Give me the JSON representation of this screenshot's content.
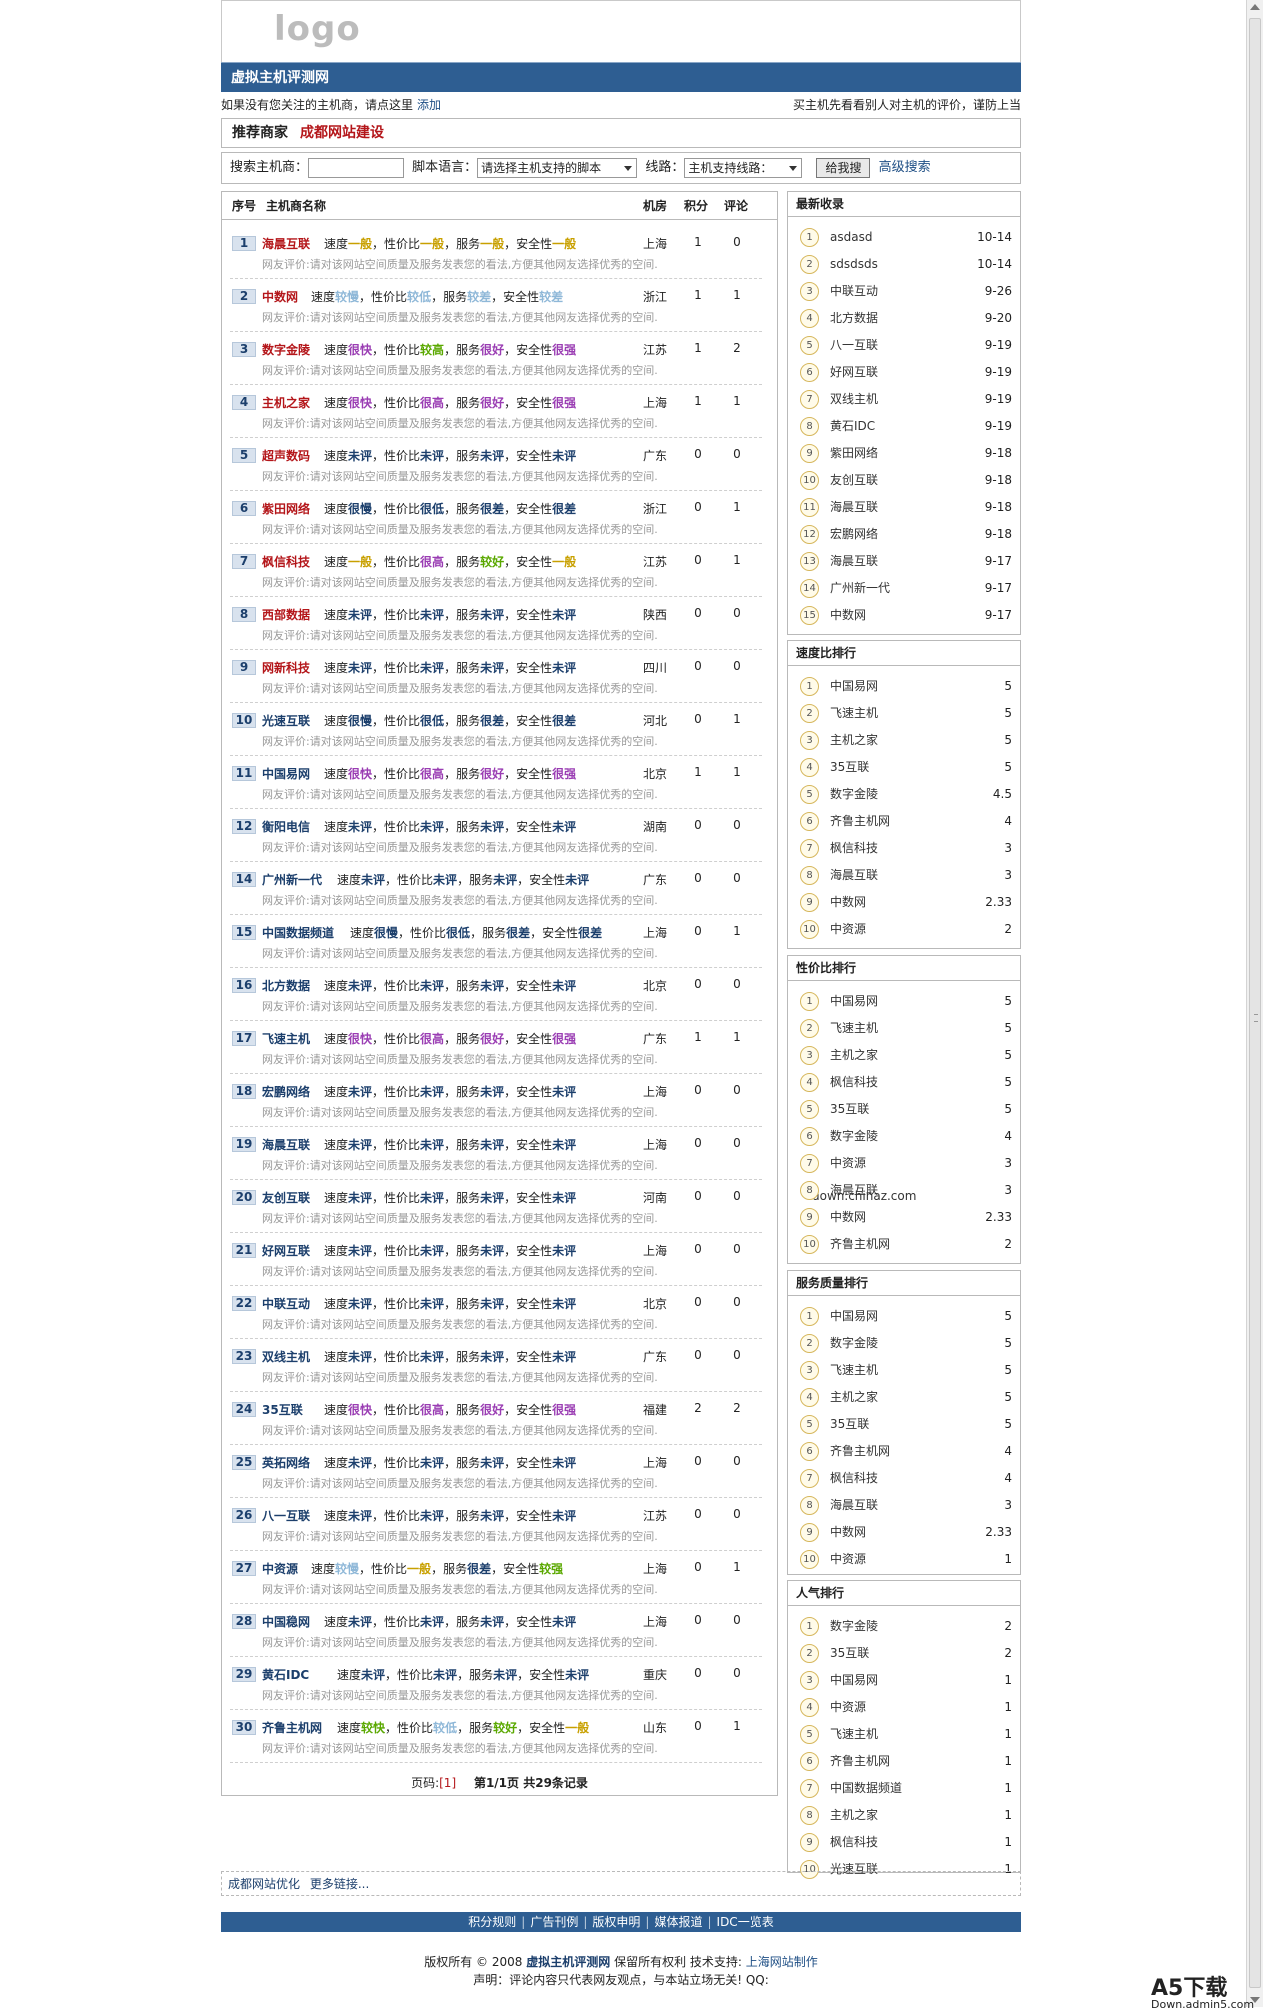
{
  "header": {
    "logo": "logo",
    "site_title": "虚拟主机评测网"
  },
  "notice": {
    "left": "如果没有您关注的主机商，请点这里",
    "add_link": "添加",
    "right": "买主机先看看别人对主机的评价，谨防上当"
  },
  "recommend": {
    "label": "推荐商家",
    "merchant": "成都网站建设"
  },
  "search": {
    "host_label": "搜索主机商：",
    "host_value": "",
    "script_label": "脚本语言：",
    "script_selected": "请选择主机支持的脚本",
    "line_label": "线路：",
    "line_selected": "主机支持线路：",
    "submit": "给我搜",
    "advanced": "高级搜索"
  },
  "table": {
    "col_no": "序号",
    "col_name": "主机商名称",
    "col_room": "机房",
    "col_score": "积分",
    "col_comment": "评论",
    "review_text": "网友评价:请对该网站空间质量及服务发表您的看法,方便其他网友选择优秀的空间.",
    "labels": {
      "speed": "速度",
      "value": "，性价比",
      "service": "，服务",
      "security": "，安全性"
    },
    "rows": [
      {
        "no": "1",
        "name": "海晨互联",
        "name_color": "#b4161a",
        "speed": "一般",
        "speed_c": "#c8a000",
        "value": "一般",
        "value_c": "#c8a000",
        "service": "一般",
        "service_c": "#c8a000",
        "security": "一般",
        "security_c": "#c8a000",
        "room": "上海",
        "score": "1",
        "comments": "0"
      },
      {
        "no": "2",
        "name": "中数网",
        "name_color": "#b4161a",
        "speed": "较慢",
        "speed_c": "#8fb8d8",
        "value": "较低",
        "value_c": "#8fb8d8",
        "service": "较差",
        "service_c": "#8fb8d8",
        "security": "较差",
        "security_c": "#8fb8d8",
        "room": "浙江",
        "score": "1",
        "comments": "1"
      },
      {
        "no": "3",
        "name": "数字金陵",
        "name_color": "#b4161a",
        "speed": "很快",
        "speed_c": "#9a3db3",
        "value": "较高",
        "value_c": "#5aa800",
        "service": "很好",
        "service_c": "#9a3db3",
        "security": "很强",
        "security_c": "#9a3db3",
        "room": "江苏",
        "score": "1",
        "comments": "2"
      },
      {
        "no": "4",
        "name": "主机之家",
        "name_color": "#b4161a",
        "speed": "很快",
        "speed_c": "#9a3db3",
        "value": "很高",
        "value_c": "#9a3db3",
        "service": "很好",
        "service_c": "#9a3db3",
        "security": "很强",
        "security_c": "#9a3db3",
        "room": "上海",
        "score": "1",
        "comments": "1"
      },
      {
        "no": "5",
        "name": "超声数码",
        "name_color": "#b4161a",
        "speed": "未评",
        "speed_c": "#1c3f6c",
        "value": "未评",
        "value_c": "#1c3f6c",
        "service": "未评",
        "service_c": "#1c3f6c",
        "security": "未评",
        "security_c": "#1c3f6c",
        "room": "广东",
        "score": "0",
        "comments": "0"
      },
      {
        "no": "6",
        "name": "紫田网络",
        "name_color": "#b4161a",
        "speed": "很慢",
        "speed_c": "#1c3f6c",
        "value": "很低",
        "value_c": "#1c3f6c",
        "service": "很差",
        "service_c": "#1c3f6c",
        "security": "很差",
        "security_c": "#1c3f6c",
        "room": "浙江",
        "score": "0",
        "comments": "1"
      },
      {
        "no": "7",
        "name": "枫信科技",
        "name_color": "#b4161a",
        "speed": "一般",
        "speed_c": "#c8a000",
        "value": "很高",
        "value_c": "#9a3db3",
        "service": "较好",
        "service_c": "#5aa800",
        "security": "一般",
        "security_c": "#c8a000",
        "room": "江苏",
        "score": "0",
        "comments": "1"
      },
      {
        "no": "8",
        "name": "西部数据",
        "name_color": "#b4161a",
        "speed": "未评",
        "speed_c": "#1c3f6c",
        "value": "未评",
        "value_c": "#1c3f6c",
        "service": "未评",
        "service_c": "#1c3f6c",
        "security": "未评",
        "security_c": "#1c3f6c",
        "room": "陕西",
        "score": "0",
        "comments": "0"
      },
      {
        "no": "9",
        "name": "网新科技",
        "name_color": "#b4161a",
        "speed": "未评",
        "speed_c": "#1c3f6c",
        "value": "未评",
        "value_c": "#1c3f6c",
        "service": "未评",
        "service_c": "#1c3f6c",
        "security": "未评",
        "security_c": "#1c3f6c",
        "room": "四川",
        "score": "0",
        "comments": "0"
      },
      {
        "no": "10",
        "name": "光速互联",
        "name_color": "#1c3f6c",
        "speed": "很慢",
        "speed_c": "#1c3f6c",
        "value": "很低",
        "value_c": "#1c3f6c",
        "service": "很差",
        "service_c": "#1c3f6c",
        "security": "很差",
        "security_c": "#1c3f6c",
        "room": "河北",
        "score": "0",
        "comments": "1"
      },
      {
        "no": "11",
        "name": "中国易网",
        "name_color": "#1c3f6c",
        "speed": "很快",
        "speed_c": "#9a3db3",
        "value": "很高",
        "value_c": "#9a3db3",
        "service": "很好",
        "service_c": "#9a3db3",
        "security": "很强",
        "security_c": "#9a3db3",
        "room": "北京",
        "score": "1",
        "comments": "1"
      },
      {
        "no": "12",
        "name": "衡阳电信",
        "name_color": "#1c3f6c",
        "speed": "未评",
        "speed_c": "#1c3f6c",
        "value": "未评",
        "value_c": "#1c3f6c",
        "service": "未评",
        "service_c": "#1c3f6c",
        "security": "未评",
        "security_c": "#1c3f6c",
        "room": "湖南",
        "score": "0",
        "comments": "0"
      },
      {
        "no": "14",
        "name": "广州新一代",
        "name_color": "#1c3f6c",
        "speed": "未评",
        "speed_c": "#1c3f6c",
        "value": "未评",
        "value_c": "#1c3f6c",
        "service": "未评",
        "service_c": "#1c3f6c",
        "security": "未评",
        "security_c": "#1c3f6c",
        "room": "广东",
        "score": "0",
        "comments": "0"
      },
      {
        "no": "15",
        "name": "中国数据频道",
        "name_color": "#1c3f6c",
        "speed": "很慢",
        "speed_c": "#1c3f6c",
        "value": "很低",
        "value_c": "#1c3f6c",
        "service": "很差",
        "service_c": "#1c3f6c",
        "security": "很差",
        "security_c": "#1c3f6c",
        "room": "上海",
        "score": "0",
        "comments": "1"
      },
      {
        "no": "16",
        "name": "北方数据",
        "name_color": "#1c3f6c",
        "speed": "未评",
        "speed_c": "#1c3f6c",
        "value": "未评",
        "value_c": "#1c3f6c",
        "service": "未评",
        "service_c": "#1c3f6c",
        "security": "未评",
        "security_c": "#1c3f6c",
        "room": "北京",
        "score": "0",
        "comments": "0"
      },
      {
        "no": "17",
        "name": "飞速主机",
        "name_color": "#1c3f6c",
        "speed": "很快",
        "speed_c": "#9a3db3",
        "value": "很高",
        "value_c": "#9a3db3",
        "service": "很好",
        "service_c": "#9a3db3",
        "security": "很强",
        "security_c": "#9a3db3",
        "room": "广东",
        "score": "1",
        "comments": "1"
      },
      {
        "no": "18",
        "name": "宏鹏网络",
        "name_color": "#1c3f6c",
        "speed": "未评",
        "speed_c": "#1c3f6c",
        "value": "未评",
        "value_c": "#1c3f6c",
        "service": "未评",
        "service_c": "#1c3f6c",
        "security": "未评",
        "security_c": "#1c3f6c",
        "room": "上海",
        "score": "0",
        "comments": "0"
      },
      {
        "no": "19",
        "name": "海晨互联",
        "name_color": "#1c3f6c",
        "speed": "未评",
        "speed_c": "#1c3f6c",
        "value": "未评",
        "value_c": "#1c3f6c",
        "service": "未评",
        "service_c": "#1c3f6c",
        "security": "未评",
        "security_c": "#1c3f6c",
        "room": "上海",
        "score": "0",
        "comments": "0"
      },
      {
        "no": "20",
        "name": "友创互联",
        "name_color": "#1c3f6c",
        "speed": "未评",
        "speed_c": "#1c3f6c",
        "value": "未评",
        "value_c": "#1c3f6c",
        "service": "未评",
        "service_c": "#1c3f6c",
        "security": "未评",
        "security_c": "#1c3f6c",
        "room": "河南",
        "score": "0",
        "comments": "0"
      },
      {
        "no": "21",
        "name": "好网互联",
        "name_color": "#1c3f6c",
        "speed": "未评",
        "speed_c": "#1c3f6c",
        "value": "未评",
        "value_c": "#1c3f6c",
        "service": "未评",
        "service_c": "#1c3f6c",
        "security": "未评",
        "security_c": "#1c3f6c",
        "room": "上海",
        "score": "0",
        "comments": "0"
      },
      {
        "no": "22",
        "name": "中联互动",
        "name_color": "#1c3f6c",
        "speed": "未评",
        "speed_c": "#1c3f6c",
        "value": "未评",
        "value_c": "#1c3f6c",
        "service": "未评",
        "service_c": "#1c3f6c",
        "security": "未评",
        "security_c": "#1c3f6c",
        "room": "北京",
        "score": "0",
        "comments": "0"
      },
      {
        "no": "23",
        "name": "双线主机",
        "name_color": "#1c3f6c",
        "speed": "未评",
        "speed_c": "#1c3f6c",
        "value": "未评",
        "value_c": "#1c3f6c",
        "service": "未评",
        "service_c": "#1c3f6c",
        "security": "未评",
        "security_c": "#1c3f6c",
        "room": "广东",
        "score": "0",
        "comments": "0"
      },
      {
        "no": "24",
        "name": "35互联",
        "name_color": "#1c3f6c",
        "speed": "很快",
        "speed_c": "#9a3db3",
        "value": "很高",
        "value_c": "#9a3db3",
        "service": "很好",
        "service_c": "#9a3db3",
        "security": "很强",
        "security_c": "#9a3db3",
        "room": "福建",
        "score": "2",
        "comments": "2"
      },
      {
        "no": "25",
        "name": "英拓网络",
        "name_color": "#1c3f6c",
        "speed": "未评",
        "speed_c": "#1c3f6c",
        "value": "未评",
        "value_c": "#1c3f6c",
        "service": "未评",
        "service_c": "#1c3f6c",
        "security": "未评",
        "security_c": "#1c3f6c",
        "room": "上海",
        "score": "0",
        "comments": "0"
      },
      {
        "no": "26",
        "name": "八一互联",
        "name_color": "#1c3f6c",
        "speed": "未评",
        "speed_c": "#1c3f6c",
        "value": "未评",
        "value_c": "#1c3f6c",
        "service": "未评",
        "service_c": "#1c3f6c",
        "security": "未评",
        "security_c": "#1c3f6c",
        "room": "江苏",
        "score": "0",
        "comments": "0"
      },
      {
        "no": "27",
        "name": "中资源",
        "name_color": "#1c3f6c",
        "speed": "较慢",
        "speed_c": "#8fb8d8",
        "value": "一般",
        "value_c": "#c8a000",
        "service": "很差",
        "service_c": "#1c3f6c",
        "security": "较强",
        "security_c": "#5aa800",
        "room": "上海",
        "score": "0",
        "comments": "1"
      },
      {
        "no": "28",
        "name": "中国稳网",
        "name_color": "#1c3f6c",
        "speed": "未评",
        "speed_c": "#1c3f6c",
        "value": "未评",
        "value_c": "#1c3f6c",
        "service": "未评",
        "service_c": "#1c3f6c",
        "security": "未评",
        "security_c": "#1c3f6c",
        "room": "上海",
        "score": "0",
        "comments": "0"
      },
      {
        "no": "29",
        "name": "黄石IDC",
        "name_color": "#1c3f6c",
        "speed": "未评",
        "speed_c": "#1c3f6c",
        "value": "未评",
        "value_c": "#1c3f6c",
        "service": "未评",
        "service_c": "#1c3f6c",
        "security": "未评",
        "security_c": "#1c3f6c",
        "room": "重庆",
        "score": "0",
        "comments": "0"
      },
      {
        "no": "30",
        "name": "齐鲁主机网",
        "name_color": "#1c3f6c",
        "speed": "较快",
        "speed_c": "#5aa800",
        "value": "较低",
        "value_c": "#8fb8d8",
        "service": "较好",
        "service_c": "#5aa800",
        "security": "一般",
        "security_c": "#c8a000",
        "room": "山东",
        "score": "0",
        "comments": "1"
      }
    ]
  },
  "pager": {
    "prefix": "页码:",
    "current": "[1]",
    "summary": "第1/1页 共29条记录"
  },
  "watermark": "down.chinaz.com",
  "sidebar": {
    "latest": {
      "title": "最新收录",
      "items": [
        {
          "name": "asdasd",
          "val": "10-14"
        },
        {
          "name": "sdsdsds",
          "val": "10-14"
        },
        {
          "name": "中联互动",
          "val": "9-26"
        },
        {
          "name": "北方数据",
          "val": "9-20"
        },
        {
          "name": "八一互联",
          "val": "9-19"
        },
        {
          "name": "好网互联",
          "val": "9-19"
        },
        {
          "name": "双线主机",
          "val": "9-19"
        },
        {
          "name": "黄石IDC",
          "val": "9-19"
        },
        {
          "name": "紫田网络",
          "val": "9-18"
        },
        {
          "name": "友创互联",
          "val": "9-18"
        },
        {
          "name": "海晨互联",
          "val": "9-18"
        },
        {
          "name": "宏鹏网络",
          "val": "9-18"
        },
        {
          "name": "海晨互联",
          "val": "9-17"
        },
        {
          "name": "广州新一代",
          "val": "9-17"
        },
        {
          "name": "中数网",
          "val": "9-17"
        }
      ]
    },
    "speed": {
      "title": "速度比排行",
      "items": [
        {
          "name": "中国易网",
          "val": "5"
        },
        {
          "name": "飞速主机",
          "val": "5"
        },
        {
          "name": "主机之家",
          "val": "5"
        },
        {
          "name": "35互联",
          "val": "5"
        },
        {
          "name": "数字金陵",
          "val": "4.5"
        },
        {
          "name": "齐鲁主机网",
          "val": "4"
        },
        {
          "name": "枫信科技",
          "val": "3"
        },
        {
          "name": "海晨互联",
          "val": "3"
        },
        {
          "name": "中数网",
          "val": "2.33"
        },
        {
          "name": "中资源",
          "val": "2"
        }
      ]
    },
    "value": {
      "title": "性价比排行",
      "items": [
        {
          "name": "中国易网",
          "val": "5"
        },
        {
          "name": "飞速主机",
          "val": "5"
        },
        {
          "name": "主机之家",
          "val": "5"
        },
        {
          "name": "枫信科技",
          "val": "5"
        },
        {
          "name": "35互联",
          "val": "5"
        },
        {
          "name": "数字金陵",
          "val": "4"
        },
        {
          "name": "中资源",
          "val": "3"
        },
        {
          "name": "海晨互联",
          "val": "3"
        },
        {
          "name": "中数网",
          "val": "2.33"
        },
        {
          "name": "齐鲁主机网",
          "val": "2"
        }
      ]
    },
    "service": {
      "title": "服务质量排行",
      "items": [
        {
          "name": "中国易网",
          "val": "5"
        },
        {
          "name": "数字金陵",
          "val": "5"
        },
        {
          "name": "飞速主机",
          "val": "5"
        },
        {
          "name": "主机之家",
          "val": "5"
        },
        {
          "name": "35互联",
          "val": "5"
        },
        {
          "name": "齐鲁主机网",
          "val": "4"
        },
        {
          "name": "枫信科技",
          "val": "4"
        },
        {
          "name": "海晨互联",
          "val": "3"
        },
        {
          "name": "中数网",
          "val": "2.33"
        },
        {
          "name": "中资源",
          "val": "1"
        }
      ]
    },
    "popular": {
      "title": "人气排行",
      "items": [
        {
          "name": "数字金陵",
          "val": "2"
        },
        {
          "name": "35互联",
          "val": "2"
        },
        {
          "name": "中国易网",
          "val": "1"
        },
        {
          "name": "中资源",
          "val": "1"
        },
        {
          "name": "飞速主机",
          "val": "1"
        },
        {
          "name": "齐鲁主机网",
          "val": "1"
        },
        {
          "name": "中国数据频道",
          "val": "1"
        },
        {
          "name": "主机之家",
          "val": "1"
        },
        {
          "name": "枫信科技",
          "val": "1"
        },
        {
          "name": "光速互联",
          "val": "1"
        }
      ]
    }
  },
  "friends": {
    "link1": "成都网站优化",
    "more": "更多链接..."
  },
  "footer": {
    "links": [
      "积分规则",
      "广告刊例",
      "版权申明",
      "媒体报道",
      "IDC一览表"
    ],
    "copy_prefix": "版权所有 © 2008",
    "site_name": "虚拟主机评测网",
    "rights": "保留所有权利 技术支持:",
    "tech": "上海网站制作",
    "statement": "声明：评论内容只代表网友观点，与本站立场无关!  QQ:"
  },
  "badge": {
    "main": "A5下载",
    "sub": "Down.admin5.com"
  }
}
